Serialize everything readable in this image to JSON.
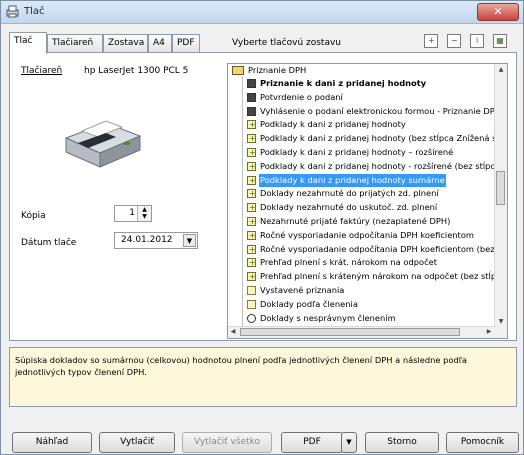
{
  "window": {
    "title": "Tlač"
  },
  "tabs": [
    "Tlač",
    "Tlačiareň",
    "Zostava",
    "A4",
    "PDF"
  ],
  "tabs_hint": "Vyberte tlačovú zostavu",
  "print": {
    "printer_label": "Tlačiareň",
    "printer_name": "hp LaserJet 1300 PCL 5",
    "copies_label": "Kópia",
    "copies_value": "1",
    "date_label": "Dátum tlače",
    "date_value": "24.01.2012"
  },
  "tree": {
    "root": "Priznanie DPH",
    "items": [
      {
        "label": "Priznanie k dani z pridanej hodnoty",
        "icon": "document-icon",
        "bold": true,
        "selected": false
      },
      {
        "label": "Potvrdenie o podaní",
        "icon": "document-icon",
        "bold": false,
        "selected": false
      },
      {
        "label": "Vyhlásenie o podaní elektronickou formou - Priznanie DPH",
        "icon": "document-icon",
        "bold": false,
        "selected": false
      },
      {
        "label": "Podklady k dani z pridanej hodnoty",
        "icon": "report-icon",
        "bold": false,
        "selected": false
      },
      {
        "label": "Podklady k dani z pridanej hodnoty (bez stĺpca Znížená sad",
        "icon": "report-icon",
        "bold": false,
        "selected": false
      },
      {
        "label": "Podklady k dani z pridanej hodnoty – rozšírené",
        "icon": "report-icon",
        "bold": false,
        "selected": false
      },
      {
        "label": "Podklady k dani z pridanej hodnoty  - rozšírené (bez stĺpca",
        "icon": "report-icon",
        "bold": false,
        "selected": false
      },
      {
        "label": "Podklady k dani z pridanej hodnoty sumárne",
        "icon": "report-icon",
        "bold": false,
        "selected": true
      },
      {
        "label": "Doklady nezahrnuté do prijatých zd. plnení",
        "icon": "report-icon",
        "bold": false,
        "selected": false
      },
      {
        "label": "Doklady nezahrnuté do uskutoč. zd. plnení",
        "icon": "report-icon",
        "bold": false,
        "selected": false
      },
      {
        "label": "Nezahrnuté prijaté faktúry (nezaplatené DPH)",
        "icon": "report-icon",
        "bold": false,
        "selected": false
      },
      {
        "label": "Ročné vysporiadanie odpočítania DPH koeficientom",
        "icon": "report-icon",
        "bold": false,
        "selected": false
      },
      {
        "label": "Ročné vysporiadanie odpočítania DPH koeficientom (bez s",
        "icon": "report-icon",
        "bold": false,
        "selected": false
      },
      {
        "label": "Prehľad plnení s krát. nárokom na odpočet",
        "icon": "report-icon",
        "bold": false,
        "selected": false
      },
      {
        "label": "Prehľad plnení s kráteným nárokom na odpočet (bez stĺpca",
        "icon": "report-icon",
        "bold": false,
        "selected": false
      },
      {
        "label": "Vystavené priznania",
        "icon": "folder-icon",
        "bold": false,
        "selected": false
      },
      {
        "label": "Doklady podľa členenia",
        "icon": "folder-icon",
        "bold": false,
        "selected": false
      },
      {
        "label": "Doklady s nesprávnym členením",
        "icon": "group-icon",
        "bold": false,
        "selected": false
      }
    ]
  },
  "description": "Súpiska dokladov so sumárnou (celkovou) hodnotou plnení podľa jednotlivých členení DPH a následne podľa jednotlivých typov členení DPH.",
  "buttons": {
    "preview": "Náhľad",
    "print": "Vytlačiť",
    "print_all": "Vytlačiť všetko",
    "pdf": "PDF",
    "cancel": "Storno",
    "help": "Pomocník"
  }
}
